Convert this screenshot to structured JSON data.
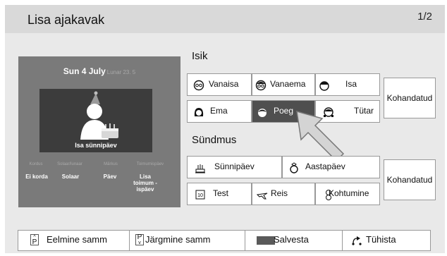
{
  "header": {
    "title": "Lisa ajakavak",
    "page_indicator": "1/2"
  },
  "preview": {
    "date": "Sun 4 July",
    "lunar": "Lunar 23. 5",
    "caption": "Isa sünnipäev",
    "option_labels": [
      "Kordus",
      "Solaar/lunaar",
      "Märkus",
      "Toimumispäev"
    ],
    "option_values": [
      "Ei korda",
      "Solaar",
      "Päev",
      "Lisa toimum -ispäev"
    ]
  },
  "person_section": {
    "title": "Isik",
    "buttons": [
      "Vanaisa",
      "Vanaema",
      "Isa",
      "Ema",
      "Poeg",
      "Tütar"
    ],
    "selected": "Poeg",
    "custom_label": "Kohandatud"
  },
  "event_section": {
    "title": "Sündmus",
    "buttons": [
      "Sünnipäev",
      "Aastapäev",
      "Test",
      "Reis",
      "Kohtumine"
    ],
    "custom_label": "Kohandatud"
  },
  "footer": {
    "prev_key": "P",
    "prev_label": "Eelmine samm",
    "next_key": "P",
    "next_label": "Järgmine samm",
    "save_label": "Salvesta",
    "cancel_label": "Tühista"
  },
  "colors": {
    "background": "#e9e9e9",
    "titlebar": "#d9d9d9",
    "preview": "#7a7a7a",
    "selected": "#4f4f4f",
    "save_swatch": "#5a5a5a"
  },
  "icons": [
    "grandfather-icon",
    "grandmother-icon",
    "father-icon",
    "mother-icon",
    "son-icon",
    "daughter-icon",
    "birthday-cake-icon",
    "ring-icon",
    "exam-icon",
    "airplane-icon",
    "meeting-icon",
    "cursor-arrow-icon",
    "return-icon"
  ]
}
